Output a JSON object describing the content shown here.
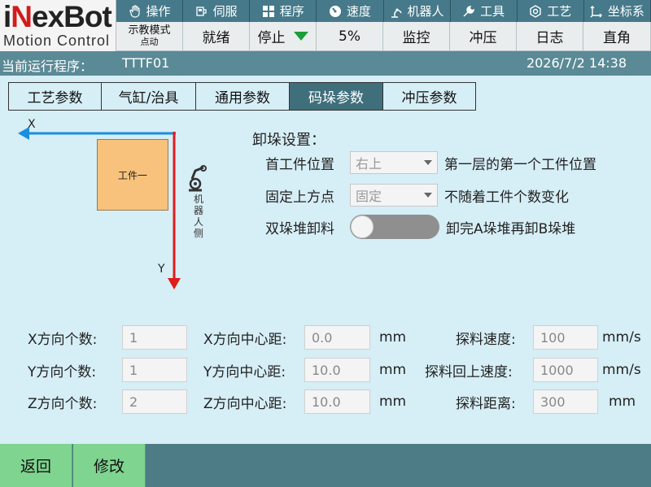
{
  "logo": {
    "brand_prefix": "i",
    "brand_accent": "N",
    "brand_rest": "exBot",
    "subtitle": "Motion Control"
  },
  "menu": [
    {
      "label": "操作",
      "icon": "hand-icon"
    },
    {
      "label": "伺服",
      "icon": "servo-icon"
    },
    {
      "label": "程序",
      "icon": "grid-icon"
    },
    {
      "label": "速度",
      "icon": "gauge-icon"
    },
    {
      "label": "机器人",
      "icon": "robot-arm-icon"
    },
    {
      "label": "工具",
      "icon": "wrench-icon"
    },
    {
      "label": "工艺",
      "icon": "process-icon"
    },
    {
      "label": "坐标系",
      "icon": "axes-icon"
    }
  ],
  "status": {
    "mode_line1": "示教模式",
    "mode_line2": "点动",
    "ready": "就绪",
    "run_state": "停止",
    "speed": "5%",
    "monitor": "监控",
    "press": "冲压",
    "log": "日志",
    "coord": "直角"
  },
  "program": {
    "label": "当前运行程序：",
    "name": "TTTF01",
    "datetime": "2026/7/2 14:38"
  },
  "tabs": [
    "工艺参数",
    "气缸/治具",
    "通用参数",
    "码垛参数",
    "冲压参数"
  ],
  "active_tab": "码垛参数",
  "diagram": {
    "x_label": "X",
    "y_label": "Y",
    "workpiece": "工件一",
    "robot_side": [
      "机",
      "器",
      "人",
      "侧"
    ]
  },
  "unload": {
    "title": "卸垛设置：",
    "first_pos_label": "首工件位置",
    "first_pos_value": "右上",
    "first_pos_desc": "第一层的第一个工件位置",
    "fixed_top_label": "固定上方点",
    "fixed_top_value": "固定",
    "fixed_top_desc": "不随着工件个数变化",
    "double_label": "双垛堆卸料",
    "double_on": false,
    "double_desc": "卸完A垛堆再卸B垛堆"
  },
  "params": [
    {
      "count_label": "X方向个数:",
      "count": "1",
      "dist_label": "X方向中心距:",
      "dist": "0.0",
      "dist_unit": "mm",
      "extra_label": "探料速度:",
      "extra": "100",
      "extra_unit": "mm/s"
    },
    {
      "count_label": "Y方向个数:",
      "count": "1",
      "dist_label": "Y方向中心距:",
      "dist": "10.0",
      "dist_unit": "mm",
      "extra_label": "探料回上速度:",
      "extra": "1000",
      "extra_unit": "mm/s"
    },
    {
      "count_label": "Z方向个数:",
      "count": "2",
      "dist_label": "Z方向中心距:",
      "dist": "10.0",
      "dist_unit": "mm",
      "extra_label": "探料距离:",
      "extra": "300",
      "extra_unit": "mm"
    }
  ],
  "buttons": {
    "back": "返回",
    "modify": "修改"
  },
  "colors": {
    "menu_bg": "#46798a",
    "active_tab": "#3f6f7b",
    "button": "#7fd48f",
    "page_bg": "#d6eef6",
    "x_axis": "#1a8fe0",
    "y_axis": "#e01c1c"
  }
}
